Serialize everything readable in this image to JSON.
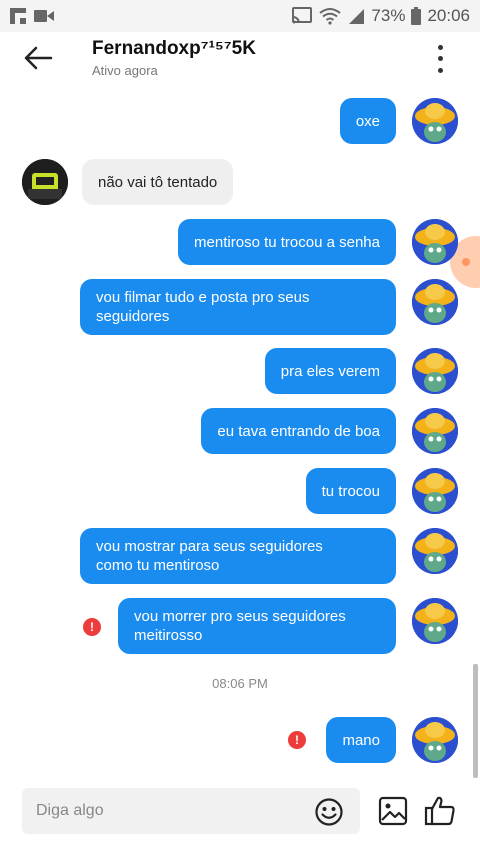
{
  "status_bar": {
    "battery": "73%",
    "time": "20:06"
  },
  "header": {
    "contact_name": "Fernandoxp⁷¹⁵⁷5K",
    "contact_status": "Ativo agora"
  },
  "messages": [
    {
      "from": "me",
      "text_lines": [
        "oxe"
      ]
    },
    {
      "from": "other",
      "text_lines": [
        "não vai tô tentado"
      ]
    },
    {
      "from": "me",
      "text_lines": [
        "mentiroso tu trocou a senha"
      ]
    },
    {
      "from": "me",
      "text_lines": [
        "vou filmar tudo e posta pro seus",
        "seguidores"
      ]
    },
    {
      "from": "me",
      "text_lines": [
        "pra eles verem"
      ]
    },
    {
      "from": "me",
      "text_lines": [
        "eu tava entrando de boa"
      ]
    },
    {
      "from": "me",
      "text_lines": [
        "tu trocou"
      ]
    },
    {
      "from": "me",
      "text_lines": [
        "vou mostrar para seus seguidores",
        "como tu mentiroso"
      ]
    },
    {
      "from": "me",
      "text_lines": [
        "vou morrer pro seus seguidores",
        "meitirosso"
      ],
      "error": true
    },
    {
      "from": "me",
      "text_lines": [
        "mano"
      ],
      "error": true
    }
  ],
  "timestamp": "08:06 PM",
  "error_glyph": "!",
  "composer": {
    "placeholder": "Diga algo"
  },
  "colors": {
    "outgoing_bubble": "#1a8cf0",
    "incoming_bubble": "#efefef",
    "error": "#ee3b3b"
  },
  "icons": [
    "back-arrow-icon",
    "more-vert-icon",
    "emoji-icon",
    "image-icon",
    "like-icon",
    "cast-icon",
    "wifi-icon",
    "signal-icon",
    "battery-icon",
    "flipboard-icon",
    "video-icon"
  ]
}
